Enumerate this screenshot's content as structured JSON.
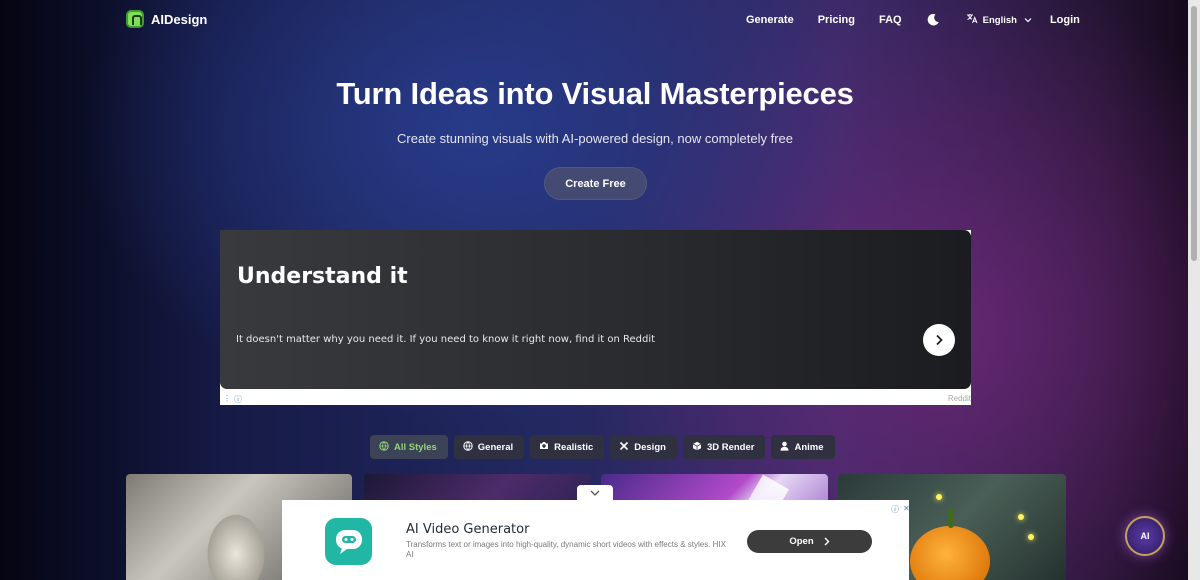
{
  "brand": {
    "name": "AIDesign"
  },
  "nav": {
    "links": [
      "Generate",
      "Pricing",
      "FAQ"
    ],
    "language": "English",
    "login": "Login"
  },
  "hero": {
    "title": "Turn Ideas into Visual Masterpieces",
    "subtitle": "Create stunning visuals with AI-powered design, now completely free",
    "cta": "Create Free"
  },
  "top_ad": {
    "headline": "Understand it",
    "text": "It doesn't matter why you need it. If you need to know it right now, find it on Reddit",
    "source": "Reddit"
  },
  "style_tabs": [
    {
      "label": "All Styles",
      "icon": "globe-icon",
      "active": true
    },
    {
      "label": "General",
      "icon": "globe-icon",
      "active": false
    },
    {
      "label": "Realistic",
      "icon": "camera-icon",
      "active": false
    },
    {
      "label": "Design",
      "icon": "tools-icon",
      "active": false
    },
    {
      "label": "3D Render",
      "icon": "cube-icon",
      "active": false
    },
    {
      "label": "Anime",
      "icon": "person-icon",
      "active": false
    }
  ],
  "bottom_ad": {
    "title": "AI Video Generator",
    "description": "Transforms text or images into high-quality, dynamic short videos with effects & styles. HIX AI",
    "button": "Open"
  },
  "ai_button": "AI",
  "colors": {
    "accent_green": "#93d37c",
    "logo_green": "#7ee05a",
    "ad_icon_teal": "#21b7a4"
  }
}
